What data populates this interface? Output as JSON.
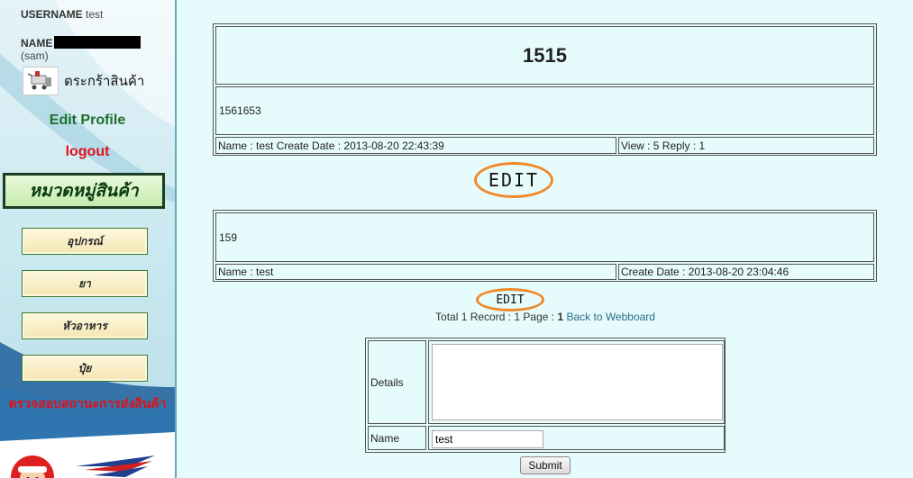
{
  "sidebar": {
    "username_label": "USERNAME",
    "username_value": "test",
    "name_label": "NAME",
    "name_sub": "(sam)",
    "cart_label": "ตระกร้าสินค้า",
    "edit_profile": "Edit Profile",
    "logout": "logout",
    "category_header": "หมวดหมู่สินค้า",
    "categories": [
      "อุปกรณ์",
      "ยา",
      "หัวอาหาร",
      "ปุ๋ย"
    ],
    "track_link": "ตรวจสอบสถานะการส่งสินค้า"
  },
  "post": {
    "title": "1515",
    "body": "1561653",
    "meta_left": "Name : test Create Date : 2013-08-20 22:43:39",
    "meta_right": "View : 5 Reply : 1"
  },
  "annotations": {
    "edit_big": "EDIT",
    "edit_small": "EDIT"
  },
  "reply": {
    "body": "159",
    "meta_left": "Name : test",
    "meta_right": "Create Date : 2013-08-20 23:04:46"
  },
  "pager": {
    "text_prefix": "Total 1 Record : 1 Page : ",
    "current_page": "1",
    "back_link": "Back to Webboard"
  },
  "form": {
    "details_label": "Details",
    "details_value": "",
    "name_label": "Name",
    "name_value": "test",
    "submit_label": "Submit"
  },
  "colors": {
    "background": "#e6fbfb",
    "accent_green": "#1f6e2e",
    "accent_red": "#e0101a",
    "edit_oval": "#f08a2a"
  }
}
